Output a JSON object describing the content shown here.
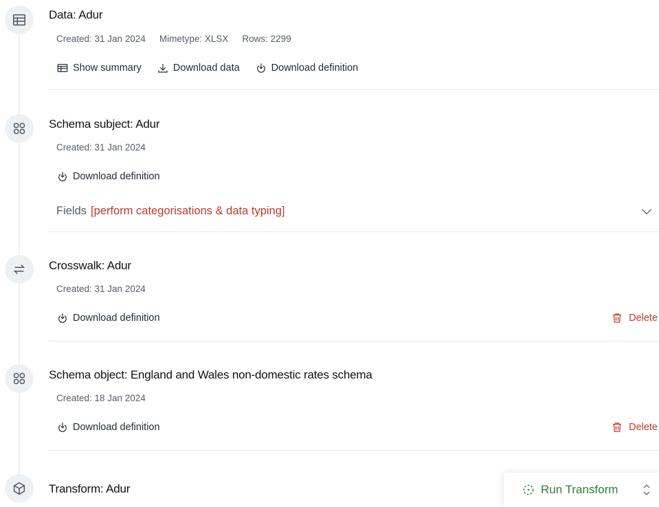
{
  "steps": [
    {
      "icon": "table-icon",
      "title": "Data: Adur",
      "meta": [
        "Created: 31 Jan 2024",
        "Mimetype: XLSX",
        "Rows: 2299"
      ],
      "actions": [
        "Show summary",
        "Download data",
        "Download definition"
      ]
    },
    {
      "icon": "schema-grid-icon",
      "title": "Schema subject: Adur",
      "meta": [
        "Created: 31 Jan 2024"
      ],
      "actions": [
        "Download definition"
      ],
      "fields_label": "Fields",
      "fields_hint": "[perform categorisations & data typing]"
    },
    {
      "icon": "swap-arrows-icon",
      "title": "Crosswalk: Adur",
      "meta": [
        "Created: 31 Jan 2024"
      ],
      "actions": [
        "Download definition"
      ],
      "delete_label": "Delete"
    },
    {
      "icon": "schema-grid-icon",
      "title": "Schema object: England and Wales non-domestic rates schema",
      "meta": [
        "Created: 18 Jan 2024"
      ],
      "actions": [
        "Download definition"
      ],
      "delete_label": "Delete"
    },
    {
      "icon": "cube-icon",
      "title": "Transform: Adur"
    }
  ],
  "run_panel": {
    "run_label": "Run Transform"
  },
  "colors": {
    "danger": "#c0392b",
    "success": "#2e7d32",
    "icon_bg": "#eef1f4",
    "divider": "#e3e6e9"
  }
}
